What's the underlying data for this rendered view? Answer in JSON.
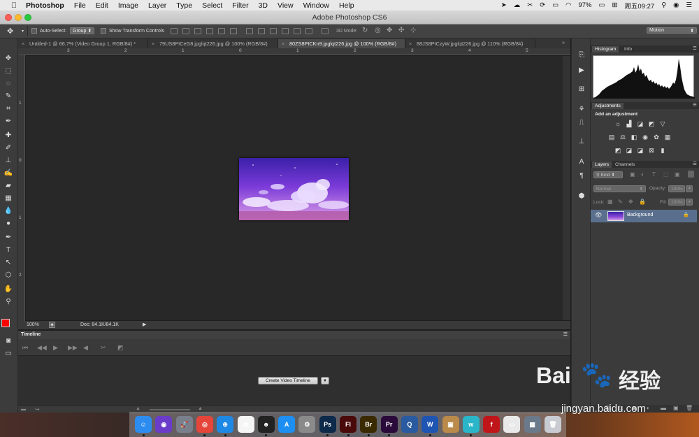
{
  "menubar": {
    "app_name": "Photoshop",
    "items": [
      "File",
      "Edit",
      "Image",
      "Layer",
      "Type",
      "Select",
      "Filter",
      "3D",
      "View",
      "Window",
      "Help"
    ],
    "battery": "97%",
    "clock": "周五09:27"
  },
  "window": {
    "title": "Adobe Photoshop CS6"
  },
  "options_bar": {
    "auto_select_label": "Auto-Select:",
    "auto_select_value": "Group",
    "show_transform_label": "Show Transform Controls",
    "mode_3d_label": "3D Mode:",
    "workspace_value": "Motion"
  },
  "tabs": [
    {
      "label": "Untitled-1 @ 66.7% (Video Group 1, RGB/8#) *"
    },
    {
      "label": "79US8PICeG8.jpglqt226.jpg @ 100% (RGB/8#)"
    },
    {
      "label": "80ZS8PICKn9.jpglqt226.jpg @ 100% (RGB/8#)"
    },
    {
      "label": "88JS8PICzyW.jpglqt226.jpg @ 110% (RGB/8#)"
    }
  ],
  "rulers": {
    "h_labels": [
      "3",
      "2",
      "1",
      "0",
      "1",
      "2",
      "3",
      "4",
      "5"
    ],
    "v_labels": [
      "1",
      "0",
      "1",
      "2"
    ]
  },
  "status_bar": {
    "zoom": "100%",
    "doc_info": "Doc: 84.1K/84.1K"
  },
  "timeline": {
    "title": "Timeline",
    "create_button": "Create Video Timeline"
  },
  "panels": {
    "histogram_tabs": [
      "Histogram",
      "Info"
    ],
    "adjustments_title": "Adjustments",
    "adjustments_subtitle": "Add an adjustment",
    "layers_tabs": [
      "Layers",
      "Channels"
    ],
    "kind_filter": "Kind",
    "blend_mode": "Normal",
    "opacity_label": "Opacity:",
    "opacity_value": "100%",
    "lock_label": "Lock:",
    "fill_label": "Fill:",
    "fill_value": "100%",
    "layer_name": "Background"
  },
  "dock": {
    "apps": [
      {
        "name": "Finder",
        "glyph": "☺",
        "color": "#2d8cf0"
      },
      {
        "name": "Siri",
        "glyph": "◉",
        "color": "#6a3cc9"
      },
      {
        "name": "Launchpad",
        "glyph": "🚀",
        "color": "#7a7f8c"
      },
      {
        "name": "Chrome",
        "glyph": "◎",
        "color": "#e6453a"
      },
      {
        "name": "Safari",
        "glyph": "⊕",
        "color": "#1e88e5"
      },
      {
        "name": "Photos",
        "glyph": "✿",
        "color": "#f5f5f5"
      },
      {
        "name": "QQ",
        "glyph": "☻",
        "color": "#222"
      },
      {
        "name": "App Store",
        "glyph": "A",
        "color": "#1d8ff3"
      },
      {
        "name": "System Preferences",
        "glyph": "⚙",
        "color": "#8a8a8a"
      },
      {
        "name": "Photoshop",
        "glyph": "Ps",
        "color": "#0d2a4a"
      },
      {
        "name": "Flash",
        "glyph": "Fl",
        "color": "#4a0a0a"
      },
      {
        "name": "Bridge",
        "glyph": "Br",
        "color": "#3a2a00"
      },
      {
        "name": "Premiere",
        "glyph": "Pr",
        "color": "#2a0a3a"
      },
      {
        "name": "QuickTime",
        "glyph": "Q",
        "color": "#2a5aa0"
      },
      {
        "name": "Word",
        "glyph": "W",
        "color": "#1e55b3"
      },
      {
        "name": "Archive Utility",
        "glyph": "▣",
        "color": "#b98a4a"
      },
      {
        "name": "Wunderlist",
        "glyph": "w",
        "color": "#2ab5c9"
      },
      {
        "name": "Flash Player",
        "glyph": "f",
        "color": "#c0161a"
      },
      {
        "name": "Preview",
        "glyph": "▭",
        "color": "#e9e9e9"
      },
      {
        "name": "Screenshot",
        "glyph": "▦",
        "color": "#6a7a8a"
      },
      {
        "name": "Trash",
        "glyph": "🗑",
        "color": "#c8ccd2"
      }
    ]
  },
  "watermark": {
    "brand": "Bai",
    "brand2": "经验",
    "url": "jingyan.baidu.com"
  }
}
